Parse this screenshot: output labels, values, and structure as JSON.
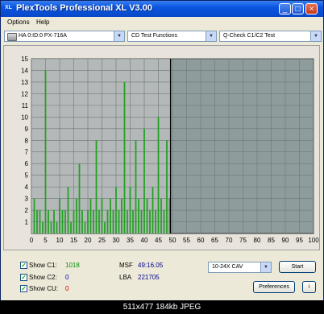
{
  "window": {
    "title": "PlexTools Professional XL V3.00",
    "app_icon": "XL"
  },
  "menu": [
    "Options",
    "Help"
  ],
  "toolbar": {
    "drive": "HA 0:ID:0  PX-716A",
    "function": "CD Test Functions",
    "test": "Q-Check C1/C2 Test"
  },
  "chart_data": {
    "type": "bar",
    "title": "",
    "xlabel": "",
    "ylabel": "",
    "x_ticks": [
      0,
      5,
      10,
      15,
      20,
      25,
      30,
      35,
      40,
      45,
      50,
      55,
      60,
      65,
      70,
      75,
      80,
      85,
      90,
      95,
      100
    ],
    "y_ticks": [
      1,
      2,
      3,
      4,
      5,
      6,
      7,
      8,
      9,
      10,
      11,
      12,
      13,
      14,
      15
    ],
    "xlim": [
      0,
      100
    ],
    "ylim": [
      0,
      15
    ],
    "grid": true,
    "progress_marker_x": 49.3,
    "series": [
      {
        "color": "#21a121",
        "x": [
          1,
          2,
          3,
          4,
          5,
          6,
          7,
          8,
          9,
          10,
          11,
          12,
          13,
          14,
          15,
          16,
          17,
          18,
          19,
          20,
          21,
          22,
          23,
          24,
          25,
          26,
          27,
          28,
          29,
          30,
          31,
          32,
          33,
          34,
          35,
          36,
          37,
          38,
          39,
          40,
          41,
          42,
          43,
          44,
          45,
          46,
          47,
          48,
          49
        ],
        "values": [
          3,
          2,
          2,
          1,
          14,
          2,
          1,
          2,
          1,
          3,
          2,
          2,
          4,
          1,
          2,
          3,
          6,
          2,
          1,
          2,
          3,
          2,
          8,
          2,
          3,
          1,
          2,
          3,
          2,
          4,
          2,
          3,
          13,
          2,
          4,
          2,
          8,
          3,
          2,
          9,
          3,
          2,
          4,
          2,
          10,
          3,
          2,
          8,
          3
        ]
      }
    ]
  },
  "stats": {
    "show_c1_label": "Show C1:",
    "c1_value": "1018",
    "show_c2_label": "Show C2:",
    "c2_value": "0",
    "show_cu_label": "Show CU:",
    "cu_value": "0",
    "msf_label": "MSF",
    "msf_value": "49:16.05",
    "lba_label": "LBA",
    "lba_value": "221705"
  },
  "controls": {
    "speed": "10-24X CAV",
    "start_label": "Start",
    "preferences_label": "Preferences"
  },
  "statusbar": "511x477  184kb  JPEG"
}
